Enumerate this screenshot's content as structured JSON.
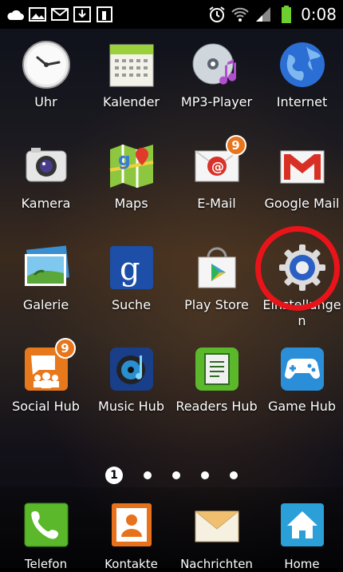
{
  "status_bar": {
    "time": "0:08",
    "notification_icons": [
      "cloud-icon",
      "gallery-icon",
      "mail-icon",
      "download-icon",
      "calendar-notif-icon"
    ],
    "system_icons": [
      "alarm-icon",
      "wifi-icon",
      "signal-icon",
      "battery-icon"
    ]
  },
  "apps": [
    {
      "label": "Uhr",
      "icon": "clock-icon"
    },
    {
      "label": "Kalender",
      "icon": "calendar-icon"
    },
    {
      "label": "MP3-Player",
      "icon": "music-disc-icon"
    },
    {
      "label": "Internet",
      "icon": "globe-icon"
    },
    {
      "label": "Kamera",
      "icon": "camera-icon"
    },
    {
      "label": "Maps",
      "icon": "maps-icon"
    },
    {
      "label": "E-Mail",
      "icon": "email-icon",
      "badge": "9"
    },
    {
      "label": "Google Mail",
      "icon": "gmail-icon"
    },
    {
      "label": "Galerie",
      "icon": "gallery-icon"
    },
    {
      "label": "Suche",
      "icon": "search-google-icon"
    },
    {
      "label": "Play Store",
      "icon": "play-store-icon"
    },
    {
      "label": "Einstellungen",
      "icon": "settings-gear-icon"
    },
    {
      "label": "Social Hub",
      "icon": "social-hub-icon",
      "badge": "9"
    },
    {
      "label": "Music Hub",
      "icon": "music-hub-icon"
    },
    {
      "label": "Readers Hub",
      "icon": "readers-hub-icon"
    },
    {
      "label": "Game Hub",
      "icon": "game-hub-icon"
    }
  ],
  "pager": {
    "active_page": "1",
    "page_count": 5
  },
  "dock": [
    {
      "label": "Telefon",
      "icon": "phone-icon"
    },
    {
      "label": "Kontakte",
      "icon": "contacts-icon"
    },
    {
      "label": "Nachrichten",
      "icon": "messages-icon"
    },
    {
      "label": "Home",
      "icon": "home-icon"
    }
  ],
  "colors": {
    "highlight": "#e8141a",
    "badge": "#e8741c"
  }
}
